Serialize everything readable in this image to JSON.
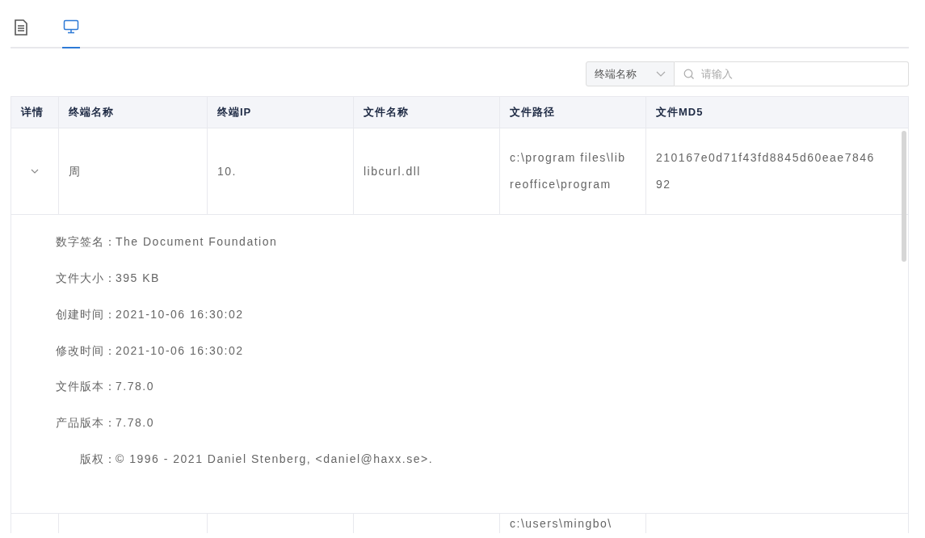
{
  "tabs": [
    {
      "kind": "document",
      "selected": false
    },
    {
      "kind": "monitor",
      "selected": true
    }
  ],
  "filter": {
    "field": "终端名称",
    "placeholder": "请输入"
  },
  "table": {
    "columns": [
      "详情",
      "终端名称",
      "终端IP",
      "文件名称",
      "文件路径",
      "文件MD5"
    ],
    "rows": [
      {
        "expanded": true,
        "cells": [
          "",
          "周",
          "10.",
          "libcurl.dll",
          "c:\\program files\\libreoffice\\program",
          "210167e0d71f43fd8845d60eae784692"
        ],
        "details": [
          {
            "label": "数字签名：",
            "value": "The Document Foundation"
          },
          {
            "label": "文件大小：",
            "value": "395 KB"
          },
          {
            "label": "创建时间：",
            "value": "2021-10-06 16:30:02"
          },
          {
            "label": "修改时间：",
            "value": "2021-10-06 16:30:02"
          },
          {
            "label": "文件版本：",
            "value": "7.78.0"
          },
          {
            "label": "产品版本：",
            "value": "7.78.0"
          },
          {
            "label": "版权：",
            "value": "© 1996 - 2021 Daniel Stenberg, <daniel@haxx.se>."
          }
        ]
      },
      {
        "cells": [
          "",
          "",
          "",
          "",
          "c:\\users\\mingbo\\",
          ""
        ]
      }
    ]
  }
}
